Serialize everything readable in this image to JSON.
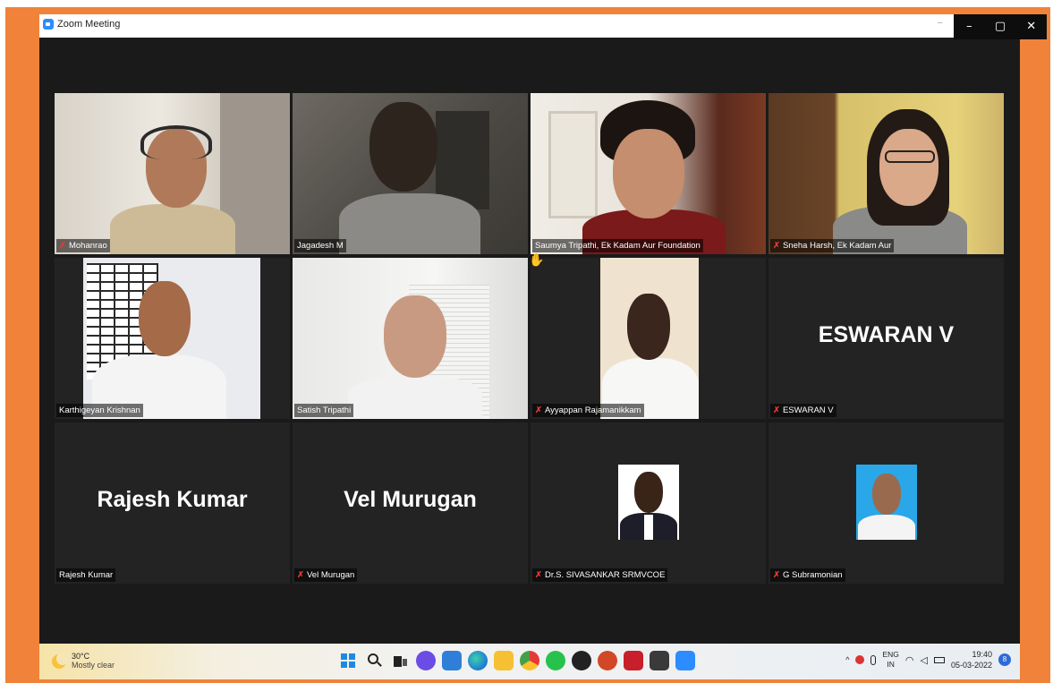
{
  "window": {
    "title": "Zoom Meeting",
    "pin_glyph": "–",
    "controls": [
      "–",
      "▢",
      "✕"
    ]
  },
  "participants": [
    {
      "name": "Mohanrao",
      "muted": true,
      "kind": "video"
    },
    {
      "name": "Jagadesh M",
      "muted": false,
      "kind": "video",
      "active_speaker": true
    },
    {
      "name": "Saumya Tripathi, Ek Kadam Aur Foundation",
      "muted": false,
      "kind": "video"
    },
    {
      "name": "Sneha Harsh, Ek Kadam Aur",
      "muted": true,
      "kind": "video"
    },
    {
      "name": "Karthigeyan Krishnan",
      "muted": false,
      "kind": "video"
    },
    {
      "name": "Satish Tripathi",
      "muted": false,
      "kind": "video"
    },
    {
      "name": "Ayyappan Rajamanikkam",
      "muted": true,
      "kind": "video"
    },
    {
      "name": "ESWARAN V",
      "muted": true,
      "kind": "name",
      "display": "ESWARAN V"
    },
    {
      "name": "Rajesh Kumar",
      "muted": false,
      "kind": "name",
      "display": "Rajesh Kumar"
    },
    {
      "name": "Vel Murugan",
      "muted": true,
      "kind": "name",
      "display": "Vel Murugan"
    },
    {
      "name": "Dr.S. SIVASANKAR SRMVCOE",
      "muted": true,
      "kind": "photo"
    },
    {
      "name": "G Subramonian",
      "muted": true,
      "kind": "photo"
    }
  ],
  "mic_muted_glyph": "✗",
  "taskbar": {
    "weather": {
      "temp": "30°C",
      "condition": "Mostly clear"
    },
    "apps": [
      "start-icon",
      "search-icon",
      "task-view-icon",
      "chat-icon",
      "widgets-icon",
      "edge-icon",
      "file-explorer-icon",
      "chrome-icon",
      "whatsapp-icon",
      "obs-icon",
      "powerpoint-icon",
      "acrobat-icon",
      "calculator-icon",
      "zoom-icon"
    ],
    "tray": {
      "chevron": "^",
      "lang_top": "ENG",
      "lang_bottom": "IN",
      "time": "19:40",
      "date": "05-03-2022",
      "notifications": "8"
    }
  },
  "colors": {
    "frame": "#f0823a",
    "window_bg": "#1a1a1a",
    "tile_bg": "#232323",
    "active_border": "#c8d96a",
    "muted_mic": "#e53935"
  }
}
